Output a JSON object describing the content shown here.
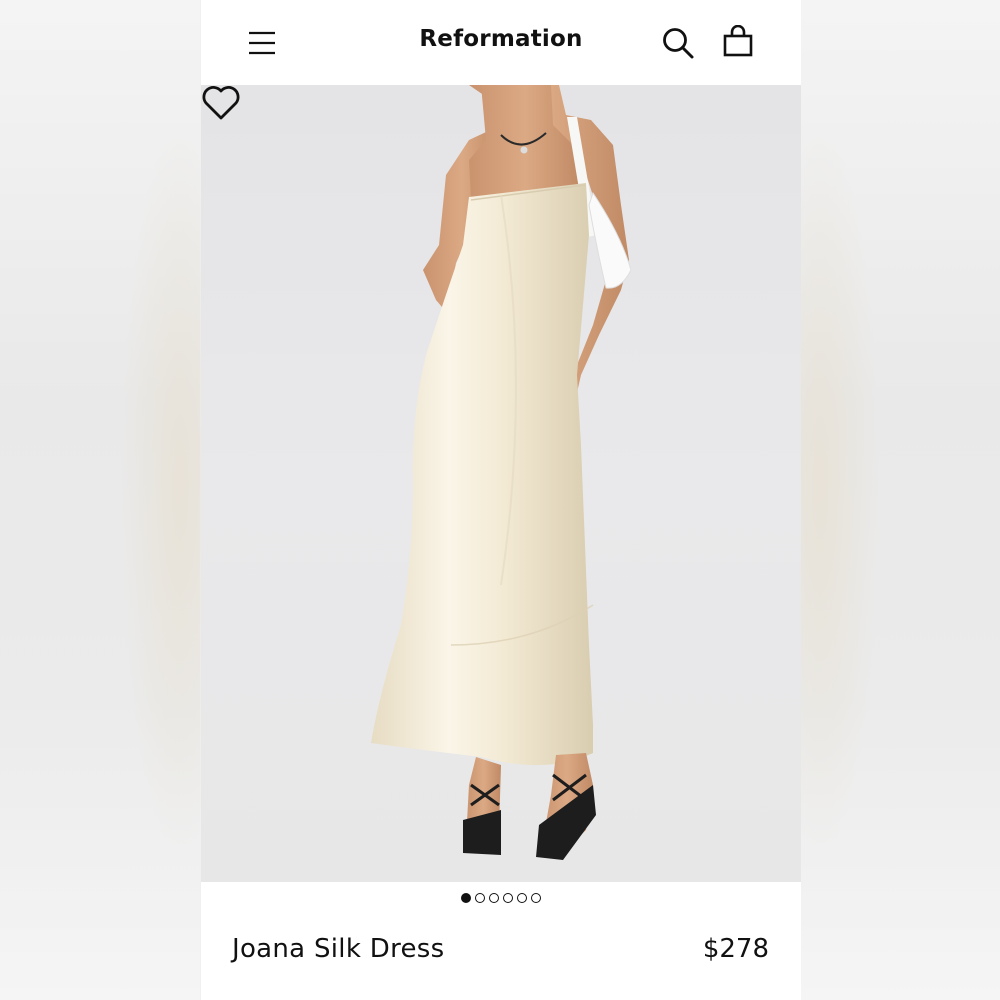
{
  "header": {
    "brand": "Reformation",
    "menu_icon": "hamburger-menu-icon",
    "search_icon": "search-icon",
    "bag_icon": "shopping-bag-icon"
  },
  "hero": {
    "favorite_icon": "heart-outline-icon",
    "image_subject": "model wearing strapless ivory silk slip dress"
  },
  "carousel": {
    "total": 6,
    "active_index": 0
  },
  "product": {
    "name": "Joana Silk Dress",
    "price": "$278"
  },
  "colors": {
    "text": "#111111",
    "background": "#ffffff",
    "hero_background": "#e7e7e9",
    "dress": "#f3ecd9"
  }
}
